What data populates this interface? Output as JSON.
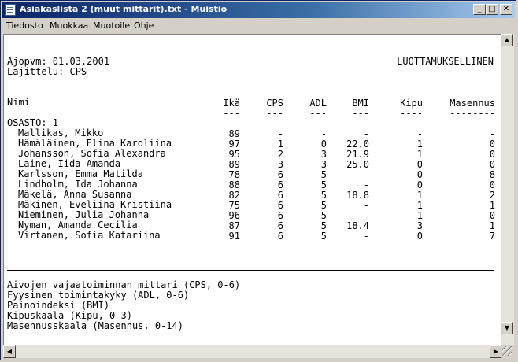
{
  "window": {
    "title": "Asiakaslista 2 (muut mittarit).txt - Muistio",
    "minimize_glyph": "_",
    "maximize_glyph": "□",
    "close_glyph": "✕"
  },
  "menu": [
    "Tiedosto",
    "Muokkaa",
    "Muotoile",
    "Ohje"
  ],
  "report": {
    "run_date": "Ajopvm: 01.03.2001",
    "confidential": "LUOTTAMUKSELLINEN",
    "sort": "Lajittelu: CPS",
    "headers": [
      "Nimi",
      "Ikä",
      "CPS",
      "ADL",
      "BMI",
      "Kipu",
      "Masennus"
    ],
    "underlines": [
      "----",
      "---",
      "---",
      "---",
      "---",
      "----",
      "--------"
    ],
    "ward": "OSASTO: 1",
    "rows": [
      {
        "name": "Mallikas, Mikko",
        "age": "89",
        "cps": "-",
        "adl": "-",
        "bmi": "-",
        "kipu": "-",
        "masennus": "-"
      },
      {
        "name": "Hämäläinen, Elina Karoliina",
        "age": "97",
        "cps": "1",
        "adl": "0",
        "bmi": "22.0",
        "kipu": "1",
        "masennus": "0"
      },
      {
        "name": "Johansson, Sofia Alexandra",
        "age": "95",
        "cps": "2",
        "adl": "3",
        "bmi": "21.9",
        "kipu": "1",
        "masennus": "0"
      },
      {
        "name": "Laine, Iida Amanda",
        "age": "89",
        "cps": "3",
        "adl": "3",
        "bmi": "25.0",
        "kipu": "0",
        "masennus": "0"
      },
      {
        "name": "Karlsson, Emma Matilda",
        "age": "78",
        "cps": "6",
        "adl": "5",
        "bmi": "-",
        "kipu": "0",
        "masennus": "8"
      },
      {
        "name": "Lindholm, Ida Johanna",
        "age": "88",
        "cps": "6",
        "adl": "5",
        "bmi": "-",
        "kipu": "0",
        "masennus": "0"
      },
      {
        "name": "Mäkelä, Anna Susanna",
        "age": "82",
        "cps": "6",
        "adl": "5",
        "bmi": "18.8",
        "kipu": "1",
        "masennus": "2"
      },
      {
        "name": "Mäkinen, Eveliina Kristiina",
        "age": "75",
        "cps": "6",
        "adl": "5",
        "bmi": "-",
        "kipu": "1",
        "masennus": "1"
      },
      {
        "name": "Nieminen, Julia Johanna",
        "age": "96",
        "cps": "6",
        "adl": "5",
        "bmi": "-",
        "kipu": "1",
        "masennus": "0"
      },
      {
        "name": "Nyman, Amanda Cecilia",
        "age": "87",
        "cps": "6",
        "adl": "5",
        "bmi": "18.4",
        "kipu": "3",
        "masennus": "1"
      },
      {
        "name": "Virtanen, Sofia Katariina",
        "age": "91",
        "cps": "6",
        "adl": "5",
        "bmi": "-",
        "kipu": "0",
        "masennus": "7"
      }
    ],
    "legend": [
      "Aivojen vajaatoiminnan mittari (CPS, 0-6)",
      "Fyysinen toimintakyky (ADL, 0-6)",
      "Painoindeksi (BMI)",
      "Kipuskaala (Kipu, 0-3)",
      "Masennusskaala (Masennus, 0-14)"
    ]
  },
  "scrollbar": {
    "up_glyph": "▲",
    "down_glyph": "▼",
    "left_glyph": "◀",
    "right_glyph": "▶"
  }
}
